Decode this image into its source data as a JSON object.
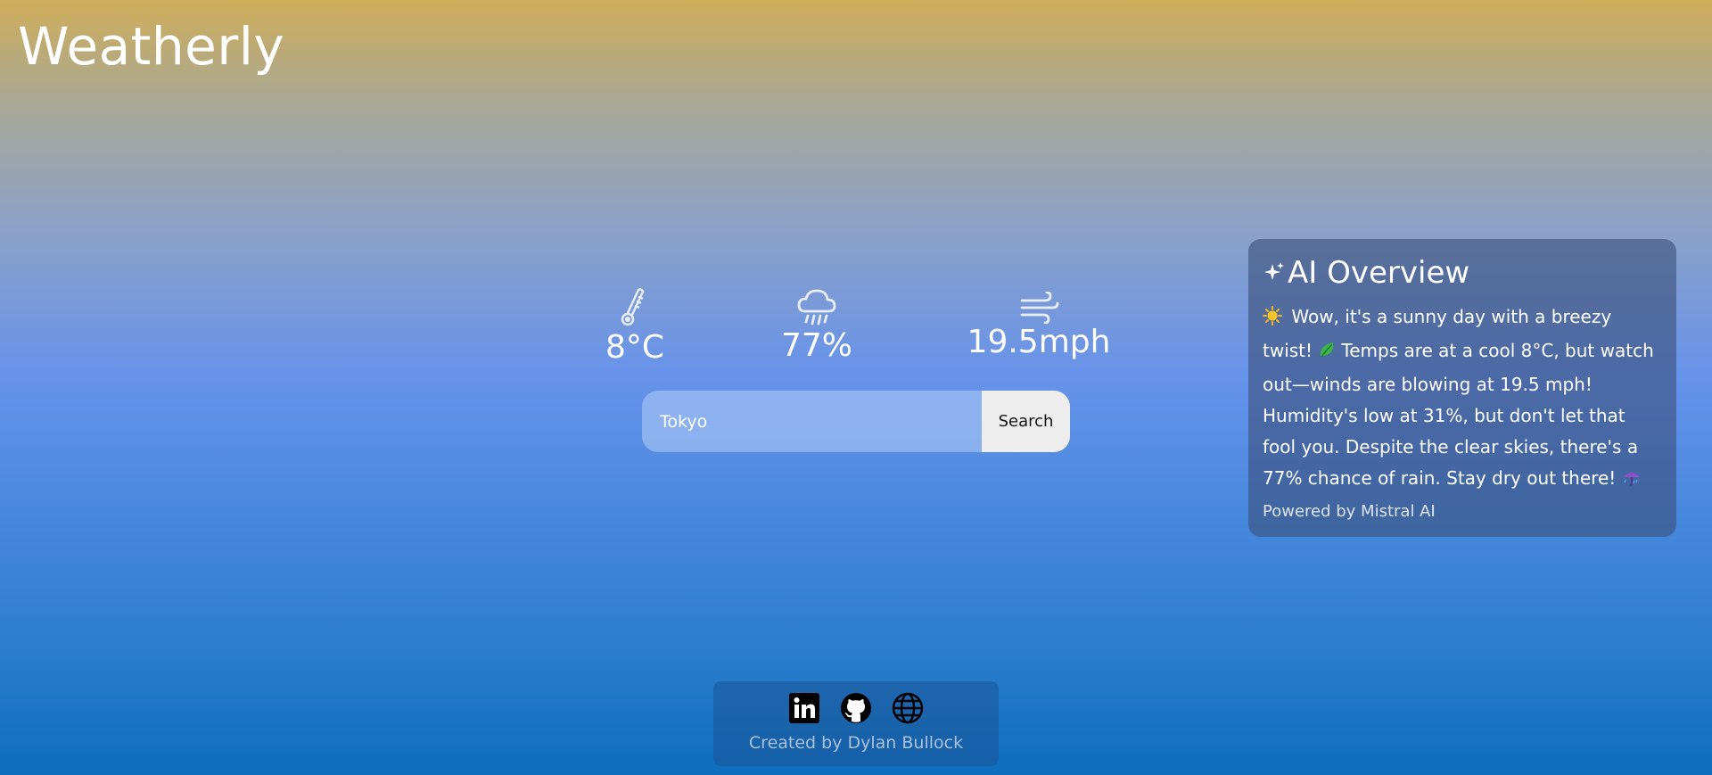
{
  "app": {
    "title": "Weatherly"
  },
  "stats": {
    "temperature": {
      "value": "8°C",
      "icon": "thermometer-icon"
    },
    "precipitation": {
      "value": "77%",
      "icon": "rain-cloud-icon"
    },
    "wind": {
      "value": "19.5mph",
      "icon": "wind-icon"
    }
  },
  "search": {
    "value": "Tokyo",
    "button_label": "Search"
  },
  "ai_overview": {
    "title": "AI Overview",
    "icon": "sparkles-icon",
    "lines": [
      {
        "emoji": "sun-icon",
        "text": "Wow, it's a sunny day with a breezy twist!"
      },
      {
        "emoji": "leaf-icon",
        "text": "Temps are at a cool 8°C, but watch out—winds are blowing at 19.5 mph! Humidity's low at 31%, but don't let that fool you. Despite the clear skies, there's a 77% chance of rain. Stay dry out there!"
      }
    ],
    "trailing_emoji": "umbrella-rain-icon",
    "footer": "Powered by Mistral AI"
  },
  "footer": {
    "links": [
      {
        "name": "linkedin",
        "icon": "linkedin-icon"
      },
      {
        "name": "github",
        "icon": "github-icon"
      },
      {
        "name": "website",
        "icon": "globe-icon"
      }
    ],
    "credit": "Created by Dylan Bullock"
  },
  "colors": {
    "gradient_top": "#cfad5a",
    "gradient_middle": "#6893ea",
    "gradient_bottom": "#0d6dbf",
    "card_bg": "#3c507d",
    "button_bg": "#eeeeee"
  }
}
